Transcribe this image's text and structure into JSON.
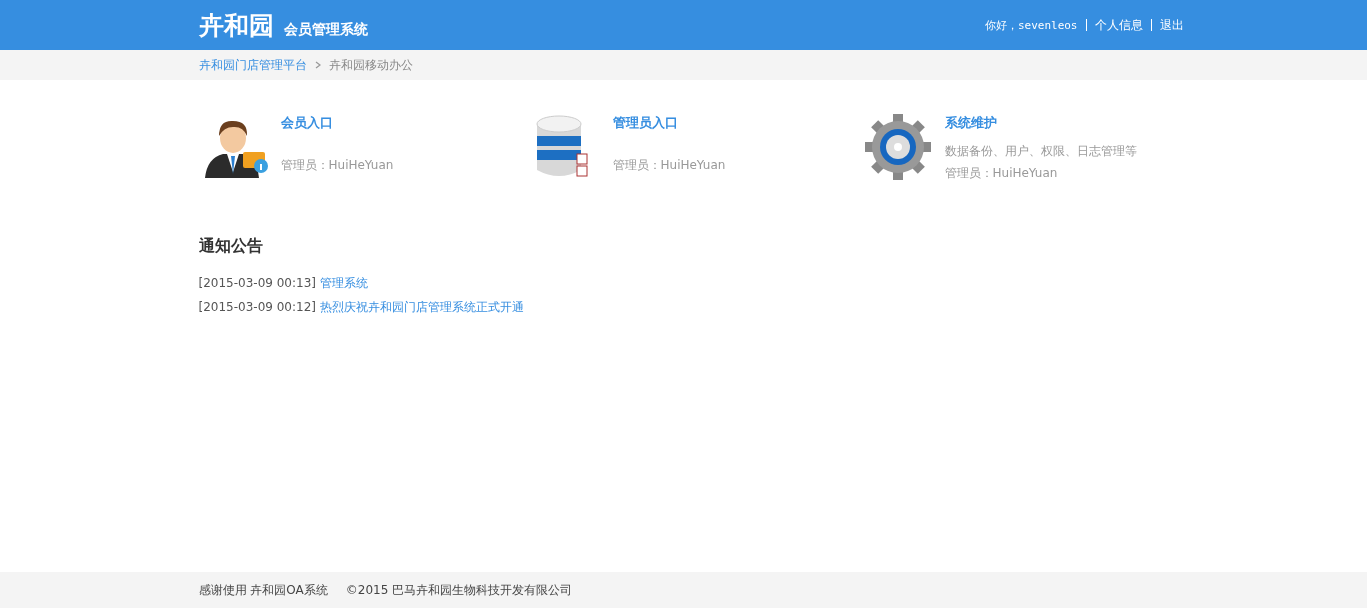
{
  "header": {
    "logo": "卉和园",
    "subtitle": "会员管理系统",
    "greeting": "你好，sevenleos",
    "links": [
      "个人信息",
      "退出"
    ]
  },
  "breadcrumb": [
    {
      "label": "卉和园门店管理平台",
      "kind": "link"
    },
    {
      "label": "卉和园移动办公",
      "kind": "current"
    }
  ],
  "entries": [
    {
      "kind": "member",
      "title": "会员入口",
      "admin": "管理员：HuiHeYuan"
    },
    {
      "kind": "database",
      "title": "管理员入口",
      "admin": "管理员：HuiHeYuan"
    },
    {
      "kind": "system",
      "title": "系统维护",
      "description": "数据备份、用户、权限、日志管理等",
      "admin": "管理员：HuiHeYuan"
    }
  ],
  "notices": {
    "title": "通知公告",
    "items": [
      {
        "time": "[2015-03-09 00:13]",
        "text": "管理系统"
      },
      {
        "time": "[2015-03-09 00:12]",
        "text": "热烈庆祝卉和园门店管理系统正式开通"
      }
    ]
  },
  "footer": {
    "thanks": "感谢使用 卉和园OA系统",
    "copyright": "©2015 巴马卉和园生物科技开发有限公司"
  }
}
